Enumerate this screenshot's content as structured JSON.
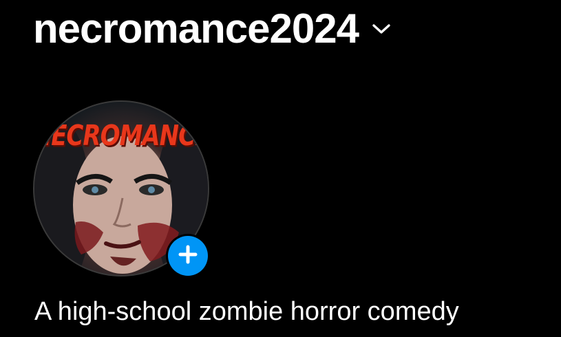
{
  "profile": {
    "username": "necromance2024",
    "avatar_title": "NECROMANCE",
    "bio": "A high-school zombie horror comedy"
  },
  "icons": {
    "username_switcher": "chevron-down-icon",
    "add_story": "plus-icon"
  },
  "colors": {
    "background": "#000000",
    "text": "#ffffff",
    "accent_blue": "#0095f6",
    "avatar_title_red": "#e8371b"
  }
}
